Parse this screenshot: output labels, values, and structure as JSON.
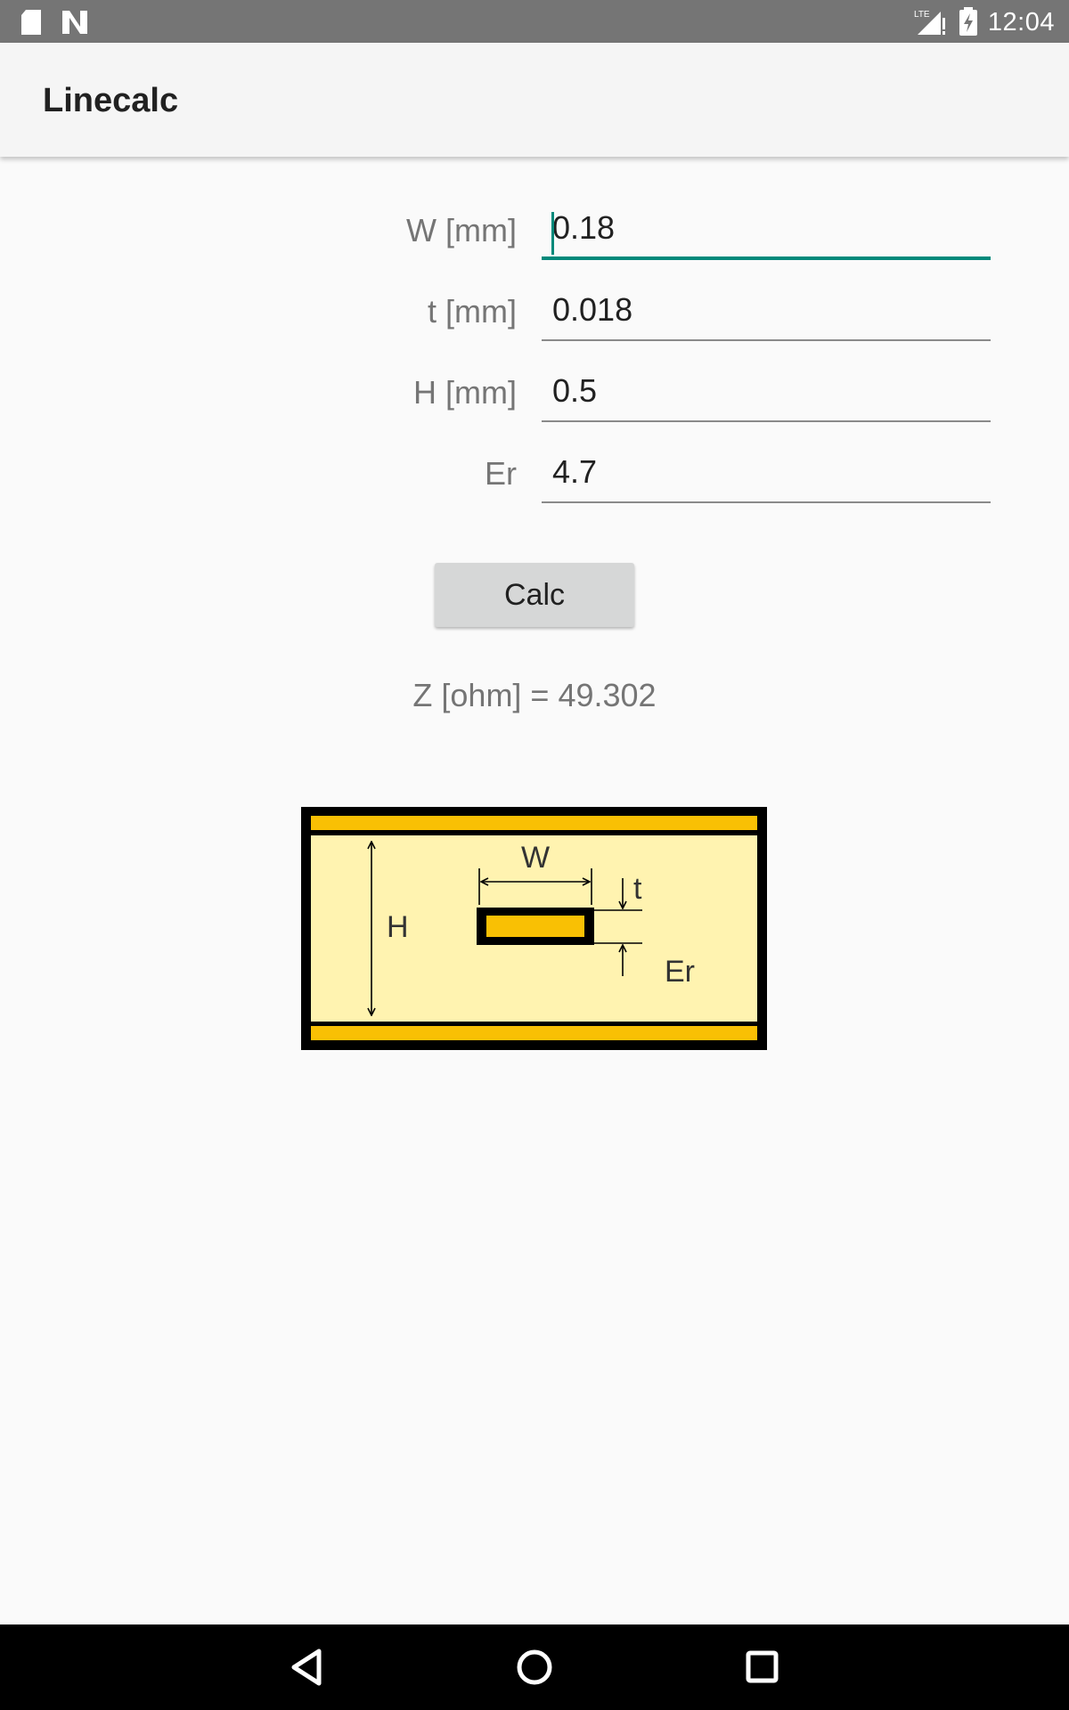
{
  "status_bar": {
    "time": "12:04",
    "lte_label": "LTE",
    "icons": [
      "sd-card-icon",
      "n-notification-icon",
      "lte-signal-icon",
      "battery-charging-icon"
    ]
  },
  "app_bar": {
    "title": "Linecalc"
  },
  "form": {
    "fields": [
      {
        "label": "W [mm]",
        "value": "0.18"
      },
      {
        "label": "t [mm]",
        "value": "0.018"
      },
      {
        "label": "H [mm]",
        "value": "0.5"
      },
      {
        "label": "Er",
        "value": "4.7"
      }
    ]
  },
  "calc_button": {
    "label": "Calc"
  },
  "result": {
    "text": "Z [ohm] = 49.302"
  },
  "diagram": {
    "labels": {
      "W": "W",
      "t": "t",
      "H": "H",
      "Er": "Er"
    },
    "colors": {
      "dielectric": "#fff3b0",
      "conductor": "#f9c004",
      "outline": "#000000"
    }
  },
  "colors": {
    "accent": "#00897b",
    "status_bar": "#757575",
    "app_bar": "#f5f5f5",
    "background": "#fafafa"
  },
  "nav_bar": {
    "buttons": [
      "back-icon",
      "home-icon",
      "recents-icon"
    ]
  }
}
